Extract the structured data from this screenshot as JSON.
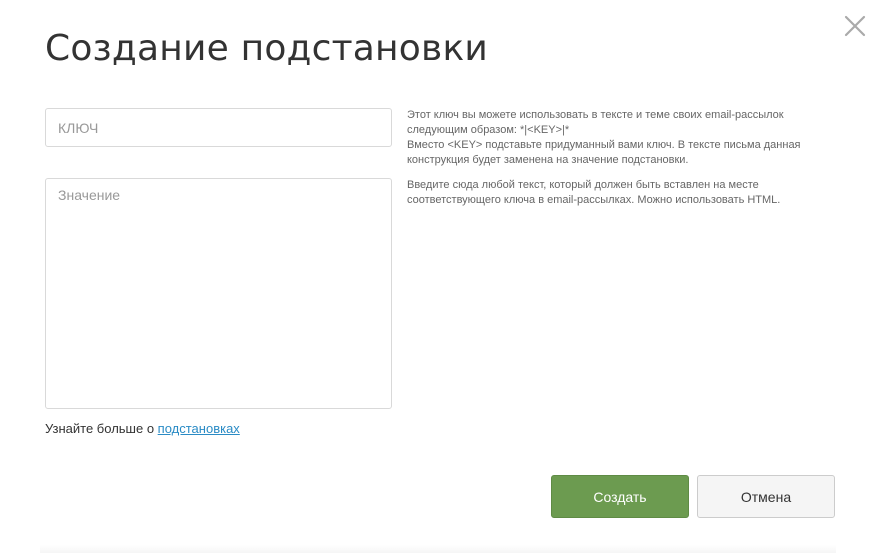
{
  "dialog": {
    "title": "Создание подстановки",
    "close_icon": "close-icon"
  },
  "form": {
    "key_placeholder": "КЛЮЧ",
    "key_value": "",
    "value_placeholder": "Значение",
    "value_value": ""
  },
  "hints": {
    "key_line1": "Этот ключ вы можете использовать в тексте и теме своих email-рассылок следующим образом: *|<KEY>|*",
    "key_line2": "Вместо <KEY> подставьте придуманный вами ключ. В тексте письма данная конструкция будет заменена на значение подстановки.",
    "value": "Введите сюда любой текст, который должен быть вставлен на месте соответствующего ключа в email-рассылках. Можно использовать HTML."
  },
  "learn_more": {
    "prefix": "Узнайте больше о ",
    "link_text": "подстановках"
  },
  "buttons": {
    "create_label": "Создать",
    "cancel_label": "Отмена"
  },
  "colors": {
    "primary": "#6c9b50",
    "link": "#2a8bc5"
  }
}
